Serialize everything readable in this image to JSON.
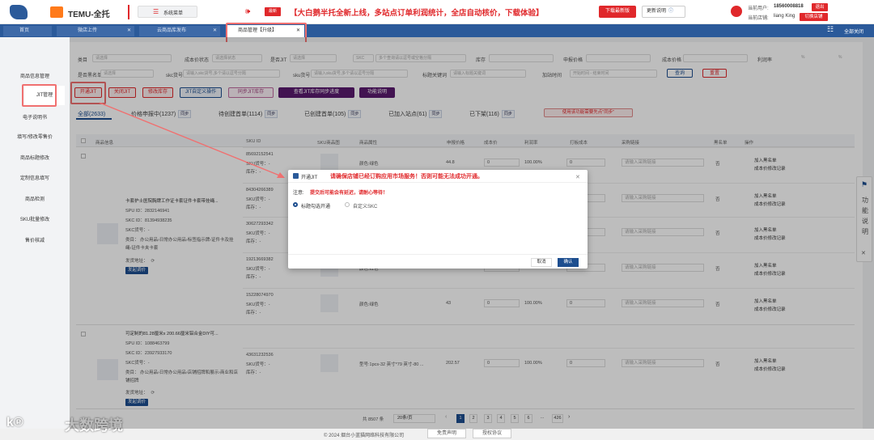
{
  "app": {
    "logo_text": "TEMU-全托",
    "menu_label": "系统菜单"
  },
  "announce": {
    "badge": "最新",
    "text": "【大白鹅半托全新上线，多站点订单利润统计，全店自动核价，下载体验】",
    "download": "下载最新版",
    "notes": "更新说明"
  },
  "user": {
    "label_user": "当前用户:",
    "phone": "18560008818",
    "logout": "退出",
    "label_shop": "当前店铺:",
    "shop": "liang King",
    "switch": "切换店铺"
  },
  "tabs": [
    {
      "label": "首页"
    },
    {
      "label": "微店上传"
    },
    {
      "label": "云商品库发布"
    },
    {
      "label": "商品管理【升级】"
    }
  ],
  "tab_closeall": "全部关闭",
  "sidebar": [
    "商品信息管理",
    "JIT管理",
    "电子说明书",
    "填写/修改零售价",
    "商品标题修改",
    "定制信息填写",
    "商品检测",
    "SKU批量修改",
    "售价核减"
  ],
  "filters": {
    "row1": [
      {
        "label": "类目",
        "placeholder": "请选择"
      },
      {
        "label": "成本价状态",
        "placeholder": "请选择状态"
      },
      {
        "label": "是否JIT",
        "placeholder": "请选择"
      },
      {
        "label": "SKC",
        "placeholder": "多个查询请以逗号或空格分隔"
      },
      {
        "label": "库存",
        "placeholder": ""
      },
      {
        "label": "申报价格",
        "placeholder": ""
      },
      {
        "label": "成本价格",
        "placeholder": ""
      },
      {
        "label": "利润率",
        "placeholder": "%"
      }
    ],
    "row2": [
      {
        "label": "是否黑名单",
        "placeholder": "请选择"
      },
      {
        "label": "skc货号",
        "placeholder": "请输入skc货号,多个请以逗号分隔"
      },
      {
        "label": "sku货号",
        "placeholder": "请输入sku货号,多个请以逗号分隔"
      },
      {
        "label": "标题关键词",
        "placeholder": "请输入标题关键词"
      },
      {
        "label": "加站时间",
        "placeholder": "开始时间    -    结束时间"
      }
    ],
    "query": "查询",
    "reset": "重置"
  },
  "actions": {
    "open_jit": "开通JIT",
    "close_jit": "关闭JIT",
    "edit_stock": "修改库存",
    "jit_custom": "JIT自定义操作",
    "sync_jit": "同步JIT库存",
    "view_jit": "查看JIT库存同步进度",
    "help": "功能说明"
  },
  "status_tabs": [
    {
      "label": "全部(2633)"
    },
    {
      "label": "价格申报中(1237)"
    },
    {
      "label": "待创建首单(1114)"
    },
    {
      "label": "已创建首单(105)"
    },
    {
      "label": "已加入站点(61)"
    },
    {
      "label": "已下架(116)"
    }
  ],
  "sync_label": "同步",
  "tip_btn": "使用该功能需要先点\"同步\"",
  "columns": [
    "商品信息",
    "SKU ID",
    "SKU商品图",
    "商品属性",
    "申报价格",
    "成本价",
    "利润率",
    "打板成本",
    "采购链接",
    "黑名单",
    "操作"
  ],
  "products": [
    {
      "title": "卡套护士医院胸牌工作证卡套证件卡套带挂绳...",
      "spu": "SPU ID：2832146941",
      "skc": "SKC ID：81394938235",
      "skc_code": "SKC货号：-",
      "cat": "类目：  办公用品›日常办公用品›标签指示牌›证件卡及挂绳›证件卡夹卡套",
      "addr": "发货地址：",
      "btn": "发起调价"
    },
    {
      "title": "可定制的81.28厘米x 200.66厘米铝合金DIY可...",
      "spu": "SPU ID：1088463799",
      "skc": "SKC ID：23927933170",
      "skc_code": "SKC货号：-",
      "cat": "类目：  办公用品›日常办公用品›店铺招牌和展示›商业和店铺招牌",
      "addr": "发货地址：",
      "btn": "发起调价"
    }
  ],
  "rows": [
    {
      "sku": "85692152541",
      "code": "SKU货号：-",
      "stock": "库存：-",
      "attr": "颜色:绿色",
      "price": "44.8",
      "cost": "0",
      "rate": "100.00%",
      "plate": "0",
      "link": "请输入采购链接",
      "black": "否",
      "a1": "加入黑名单",
      "a2": "成本价修改记录"
    },
    {
      "sku": "84304266389",
      "code": "SKU货号：-",
      "stock": "库存：-",
      "attr": "颜色:蓝色",
      "price": "44.8",
      "cost": "0",
      "rate": "100.00%",
      "plate": "0",
      "link": "请输入采购链接",
      "black": "否",
      "a1": "加入黑名单",
      "a2": "成本价修改记录"
    },
    {
      "sku": "30627293342",
      "code": "SKU货号：-",
      "stock": "库存：-",
      "attr": "颜色:黑色",
      "price": "44.8",
      "cost": "0",
      "rate": "100.00%",
      "plate": "0",
      "link": "请输入采购链接",
      "black": "否",
      "a1": "加入黑名单",
      "a2": "成本价修改记录"
    },
    {
      "sku": "19213669382",
      "code": "SKU货号：-",
      "stock": "库存：-",
      "attr": "颜色:红色",
      "price": "43",
      "cost": "0",
      "rate": "100.00%",
      "plate": "0",
      "link": "请输入采购链接",
      "black": "否",
      "a1": "加入黑名单",
      "a2": "成本价修改记录"
    },
    {
      "sku": "15228074970",
      "code": "SKU货号：-",
      "stock": "库存：-",
      "attr": "颜色:绿色",
      "price": "43",
      "cost": "0",
      "rate": "100.00%",
      "plate": "0",
      "link": "请输入采购链接",
      "black": "否",
      "a1": "加入黑名单",
      "a2": "成本价修改记录"
    },
    {
      "sku": "43631232536",
      "code": "SKU货号：-",
      "stock": "库存：-",
      "attr": "型号:1pcs-32 英寸*79 英寸-80 ...",
      "price": "202.57",
      "cost": "0",
      "rate": "100.00%",
      "plate": "0",
      "link": "请输入采购链接",
      "black": "否",
      "a1": "加入黑名单",
      "a2": "成本价修改记录"
    }
  ],
  "pagination": {
    "total": "共 8507 条",
    "size": "20条/页",
    "pages": [
      "1",
      "2",
      "3",
      "4",
      "5",
      "6",
      "...",
      "426"
    ]
  },
  "footer": {
    "copy": "© 2024 烟台小蓝猫网络科技有限公司",
    "disclaimer": "免责声明",
    "privacy": "授权协议"
  },
  "watermark": "大数跨境",
  "widget": [
    "功",
    "能",
    "说",
    "明"
  ],
  "modal": {
    "title": "开通JIT",
    "headline": "请确保店铺已经订购应用市场服务！否则可能无法成功开通。",
    "note_label": "注意:",
    "note": "提交后可能会有延迟，请耐心等待！",
    "opt1": "标题勾选开通",
    "opt2": "自定义SKC",
    "cancel": "取消",
    "confirm": "确认"
  },
  "colors": {
    "primary": "#1d4e8f",
    "accent_red": "#e0282b",
    "highlight": "#f07070"
  }
}
